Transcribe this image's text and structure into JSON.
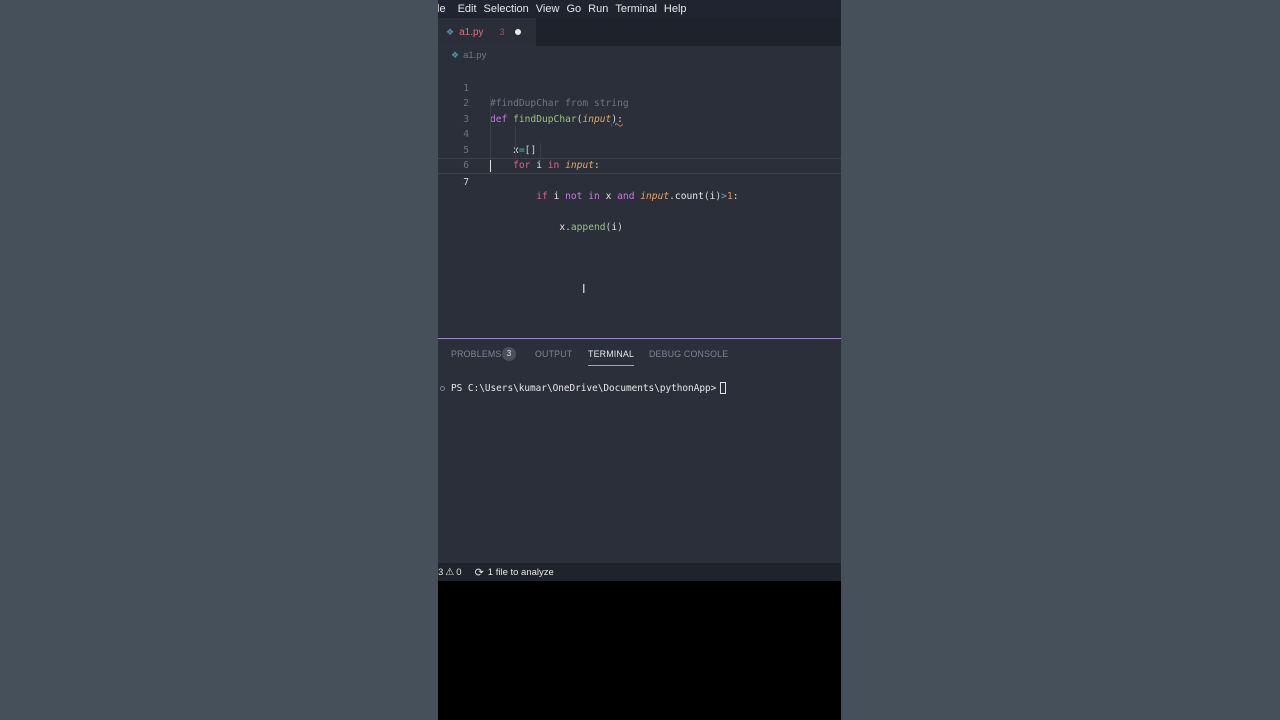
{
  "menu": {
    "items": [
      "le",
      "Edit",
      "Selection",
      "View",
      "Go",
      "Run",
      "Terminal",
      "Help"
    ]
  },
  "tab": {
    "filename": "a1.py",
    "problem_count": "3"
  },
  "breadcrumb": {
    "filename": "a1.py"
  },
  "code": {
    "line_numbers": [
      "1",
      "2",
      "3",
      "4",
      "5",
      "6",
      "7"
    ],
    "lines": [
      "#findDupChar from string",
      "def findDupChar(input):",
      "    x=[]",
      "    for i in input:",
      "        if i not in x and input.count(i)>1:",
      "            x.append(i)",
      ""
    ]
  },
  "panel": {
    "tabs": [
      "PROBLEMS",
      "OUTPUT",
      "TERMINAL",
      "DEBUG CONSOLE"
    ],
    "problems_badge": "3",
    "active_tab": "TERMINAL",
    "terminal_prompt": "PS C:\\Users\\kumar\\OneDrive\\Documents\\pythonApp>"
  },
  "status": {
    "errors": "3",
    "warnings": "0",
    "analyze_text": "1 file to analyze"
  },
  "colors": {
    "editor_bg": "#2b2f39",
    "keyword": "#c678dd",
    "function": "#98c379",
    "parameter": "#e5a567",
    "accent": "#c98ad6"
  }
}
